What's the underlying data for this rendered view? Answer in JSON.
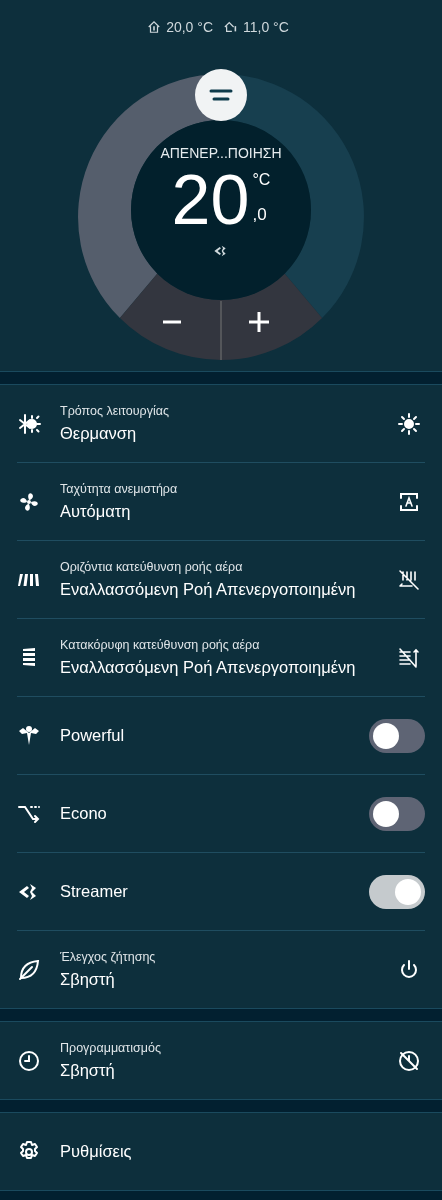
{
  "header": {
    "indoor": "20,0 °C",
    "outdoor": "11,0 °C"
  },
  "dial": {
    "mode": "ΑΠΕΝΕΡ...ΠΟΙΗΣΗ",
    "temperature": "20",
    "unit": "°C",
    "decimal": ",0"
  },
  "sections": [
    [
      {
        "kind": "value",
        "label": "Τρόπος λειτουργίας",
        "value": "Θερμανση"
      },
      {
        "kind": "value",
        "label": "Ταχύτητα ανεμιστήρα",
        "value": "Αυτόματη"
      },
      {
        "kind": "value",
        "label": "Οριζόντια κατεύθυνση ροής αέρα",
        "value": "Εναλλασσόμενη Ροή Απενεργοποιημένη"
      },
      {
        "kind": "value",
        "label": "Κατακόρυφη κατεύθυνση ροής αέρα",
        "value": "Εναλλασσόμενη Ροή Απενεργοποιημένη"
      },
      {
        "kind": "toggle",
        "label": "Powerful",
        "on": false
      },
      {
        "kind": "toggle",
        "label": "Econo",
        "on": false
      },
      {
        "kind": "toggle",
        "label": "Streamer",
        "on": true
      },
      {
        "kind": "value",
        "label": "Έλεγχος ζήτησης",
        "value": "Σβηστή"
      }
    ],
    [
      {
        "kind": "value",
        "label": "Προγραμματισμός",
        "value": "Σβηστή"
      }
    ],
    [
      {
        "kind": "link",
        "label": "Ρυθμίσεις"
      }
    ]
  ]
}
